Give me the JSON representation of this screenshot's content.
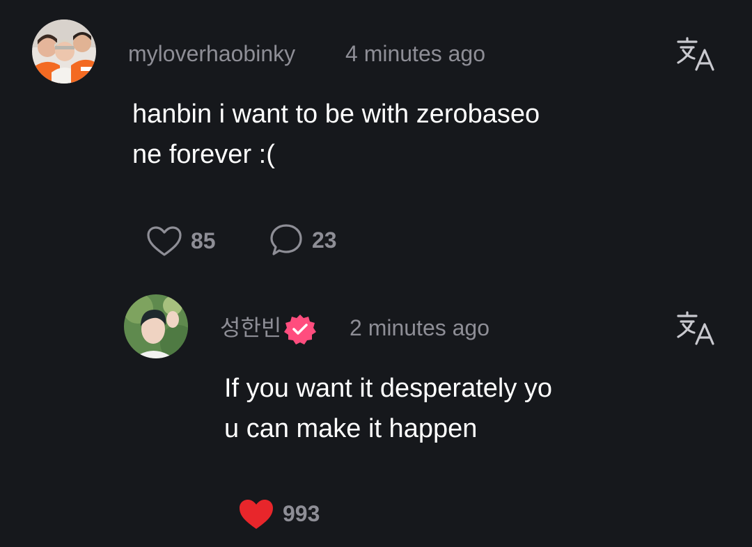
{
  "comment": {
    "username": "myloverhaobinky",
    "timestamp": "4 minutes ago",
    "text": "hanbin i want to be with zerobaseo\nne forever :(",
    "likes": "85",
    "replies": "23",
    "translate_icon": "translate-icon",
    "like_icon": "heart-outline-icon",
    "reply_icon": "speech-bubble-icon"
  },
  "reply": {
    "username": "성한빈",
    "verified_icon": "verified-badge-icon",
    "timestamp": "2 minutes ago",
    "text": "If you want it desperately yo\nu can make it happen",
    "likes": "993",
    "like_icon": "heart-filled-icon",
    "translate_icon": "translate-icon"
  },
  "colors": {
    "background": "#16181c",
    "muted_text": "#8e8e96",
    "primary_text": "#ffffff",
    "liked_heart": "#e8262b",
    "verified_badge": "#ff4d7e"
  }
}
